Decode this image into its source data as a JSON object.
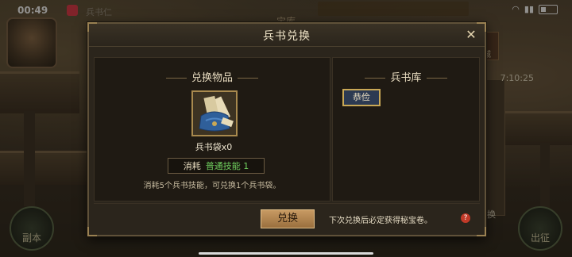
{
  "status_bar": {
    "time": "00:49",
    "ghost_text": "兵书仁"
  },
  "background": {
    "ghost_title": "宝库",
    "side_tag": "商城",
    "timer": "7:10:25",
    "bottom_left": "副本",
    "bottom_right": "出征",
    "bag_label": "换"
  },
  "dialog": {
    "title": "兵书兑换",
    "close_symbol": "✕",
    "left": {
      "section_title": "兑换物品",
      "item_name": "兵书袋x0",
      "cost_label": "消耗",
      "cost_value": "普通技能 1",
      "description": "消耗5个兵书技能，可兑换1个兵书袋。"
    },
    "right": {
      "section_title": "兵书库",
      "tab_label": "恭俭"
    },
    "footer": {
      "exchange_button": "兑换",
      "notice": "下次兑换后必定获得秘宝卷。",
      "help_symbol": "?"
    }
  },
  "colors": {
    "accent_gold": "#a8894e",
    "cost_green": "#6fcf5e",
    "button_brown": "#c79a63",
    "help_red": "#c23a28"
  }
}
